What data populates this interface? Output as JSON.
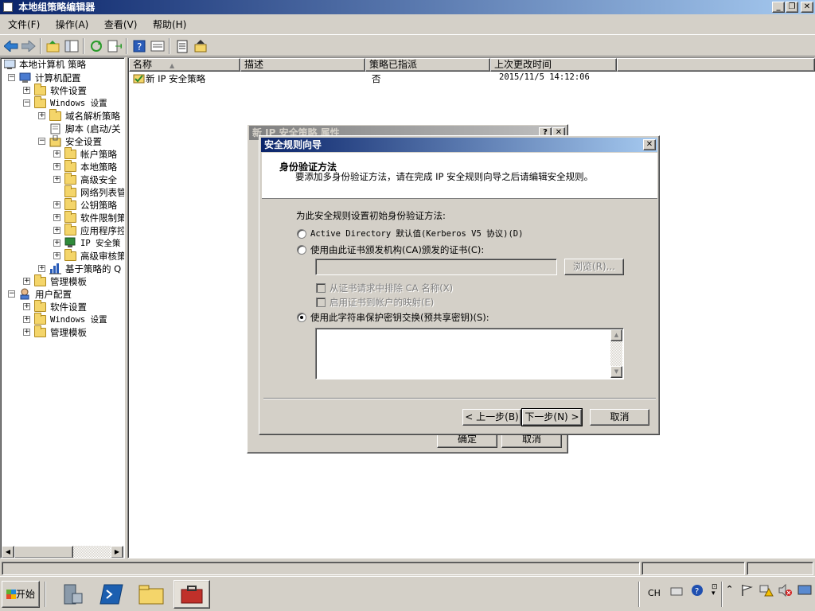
{
  "window": {
    "title": "本地组策略编辑器",
    "min": "_",
    "restore": "❐",
    "close": "✕"
  },
  "menu": [
    "文件(F)",
    "操作(A)",
    "查看(V)",
    "帮助(H)"
  ],
  "tree": {
    "root": "本地计算机 策略",
    "computer": "计算机配置",
    "software": "软件设置",
    "windows": "Windows 设置",
    "dns": "域名解析策略",
    "scripts": "脚本 (启动/关",
    "security": "安全设置",
    "account": "帐户策略",
    "local": "本地策略",
    "advfw": "高级安全",
    "netlist": "网络列表管",
    "pubkey": "公钥策略",
    "srp": "软件限制策",
    "applocker": "应用程序控",
    "ipsec": "IP 安全策",
    "audit": "高级审核策",
    "qos": "基于策略的 Q",
    "admin": "管理模板",
    "user": "用户配置",
    "u_software": "软件设置",
    "u_windows": "Windows 设置",
    "u_admin": "管理模板"
  },
  "list": {
    "headers": [
      "名称",
      "描述",
      "策略已指派",
      "上次更改时间"
    ],
    "rows": [
      {
        "name": "新 IP 安全策略",
        "desc": "",
        "assigned": "否",
        "modified": "2015/11/5 14:12:06"
      }
    ]
  },
  "props": {
    "title": "新 IP 安全策略 属性",
    "help": "?",
    "close": "✕",
    "ok": "确定",
    "cancel": "取消"
  },
  "wizard": {
    "title": "安全规则向导",
    "close": "✕",
    "heading": "身份验证方法",
    "subtitle": "要添加多身份验证方法，请在完成 IP 安全规则向导之后请编辑安全规则。",
    "prompt": "为此安全规则设置初始身份验证方法:",
    "opt_ad": "Active Directory 默认值(Kerberos V5 协议)(D)",
    "opt_ca": "使用由此证书颁发机构(CA)颁发的证书(C):",
    "browse": "浏览(R)...",
    "chk_exclude": "从证书请求中排除 CA 名称(X)",
    "chk_map": "启用证书到帐户的映射(E)",
    "opt_psk": "使用此字符串保护密钥交换(预共享密钥)(S):",
    "ca_value": "",
    "psk_value": "",
    "back": "< 上一步(B)",
    "next": "下一步(N) >",
    "cancel": "取消"
  },
  "taskbar": {
    "start": "开始",
    "lang": "CH"
  }
}
